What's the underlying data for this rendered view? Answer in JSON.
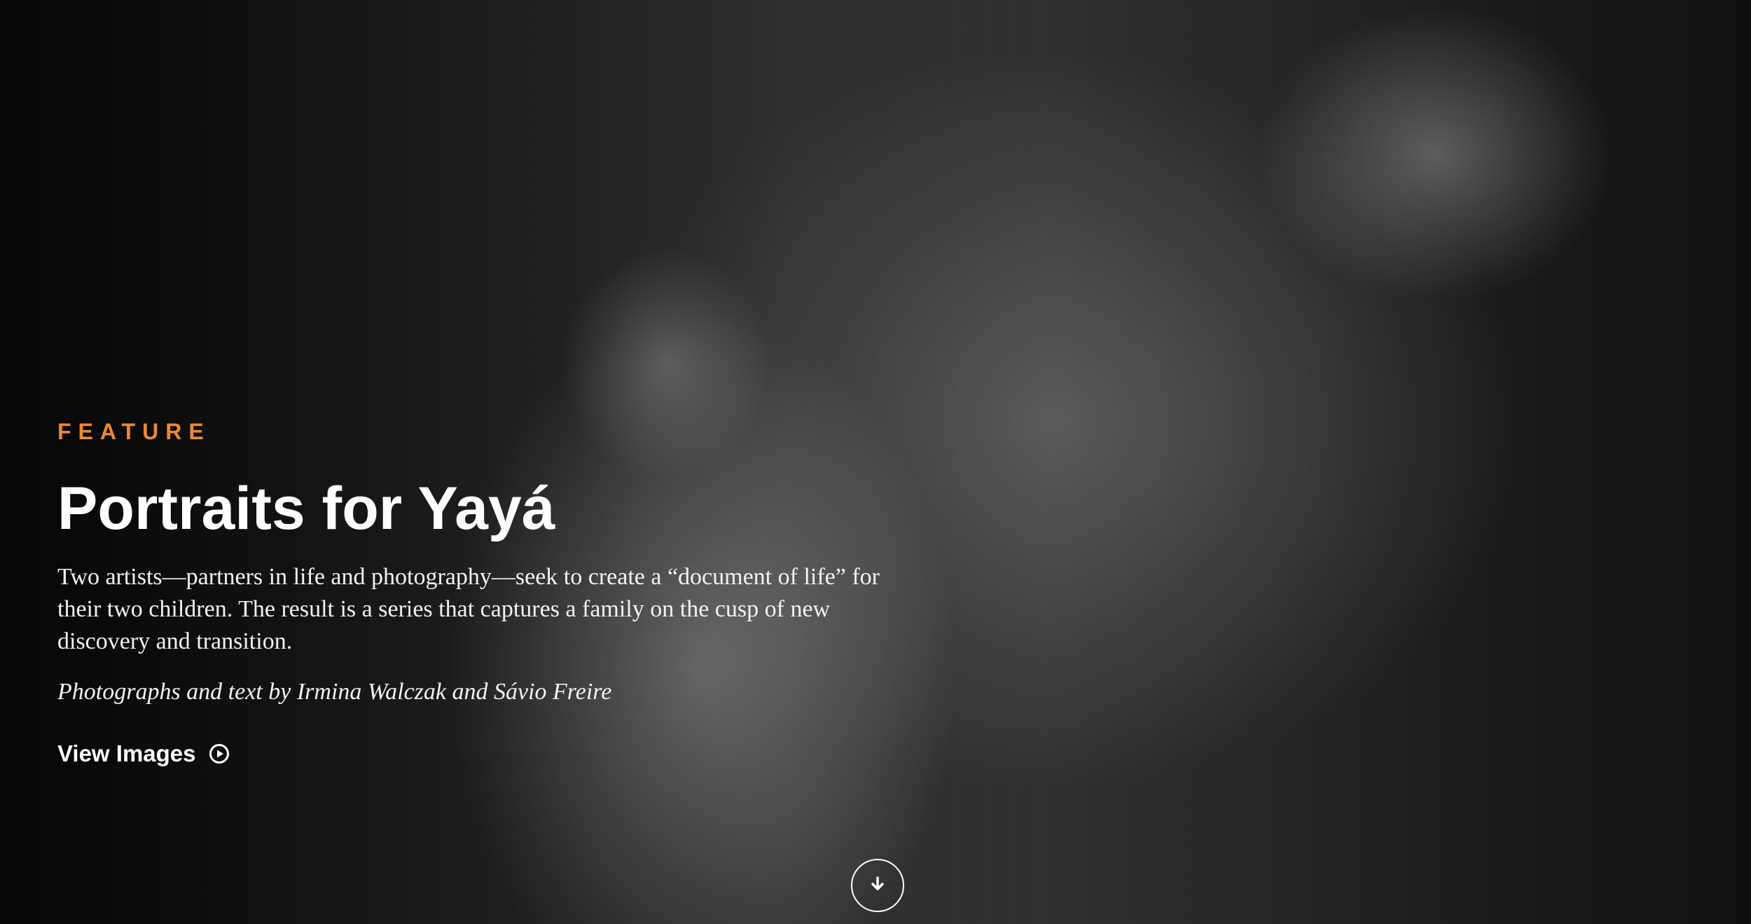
{
  "hero": {
    "kicker": "FEATURE",
    "title": "Portraits for Yayá",
    "dek": "Two artists—partners in life and photography—seek to create a “document of life” for their two children. The result is a series that captures a family on the cusp of new discovery and transition.",
    "byline": "Photographs and text by Irmina Walczak and Sávio Freire",
    "cta_label": "View Images",
    "cta_icon": "play-circle-icon",
    "scroll_icon": "arrow-down-icon",
    "accent_color": "#e88a37"
  }
}
